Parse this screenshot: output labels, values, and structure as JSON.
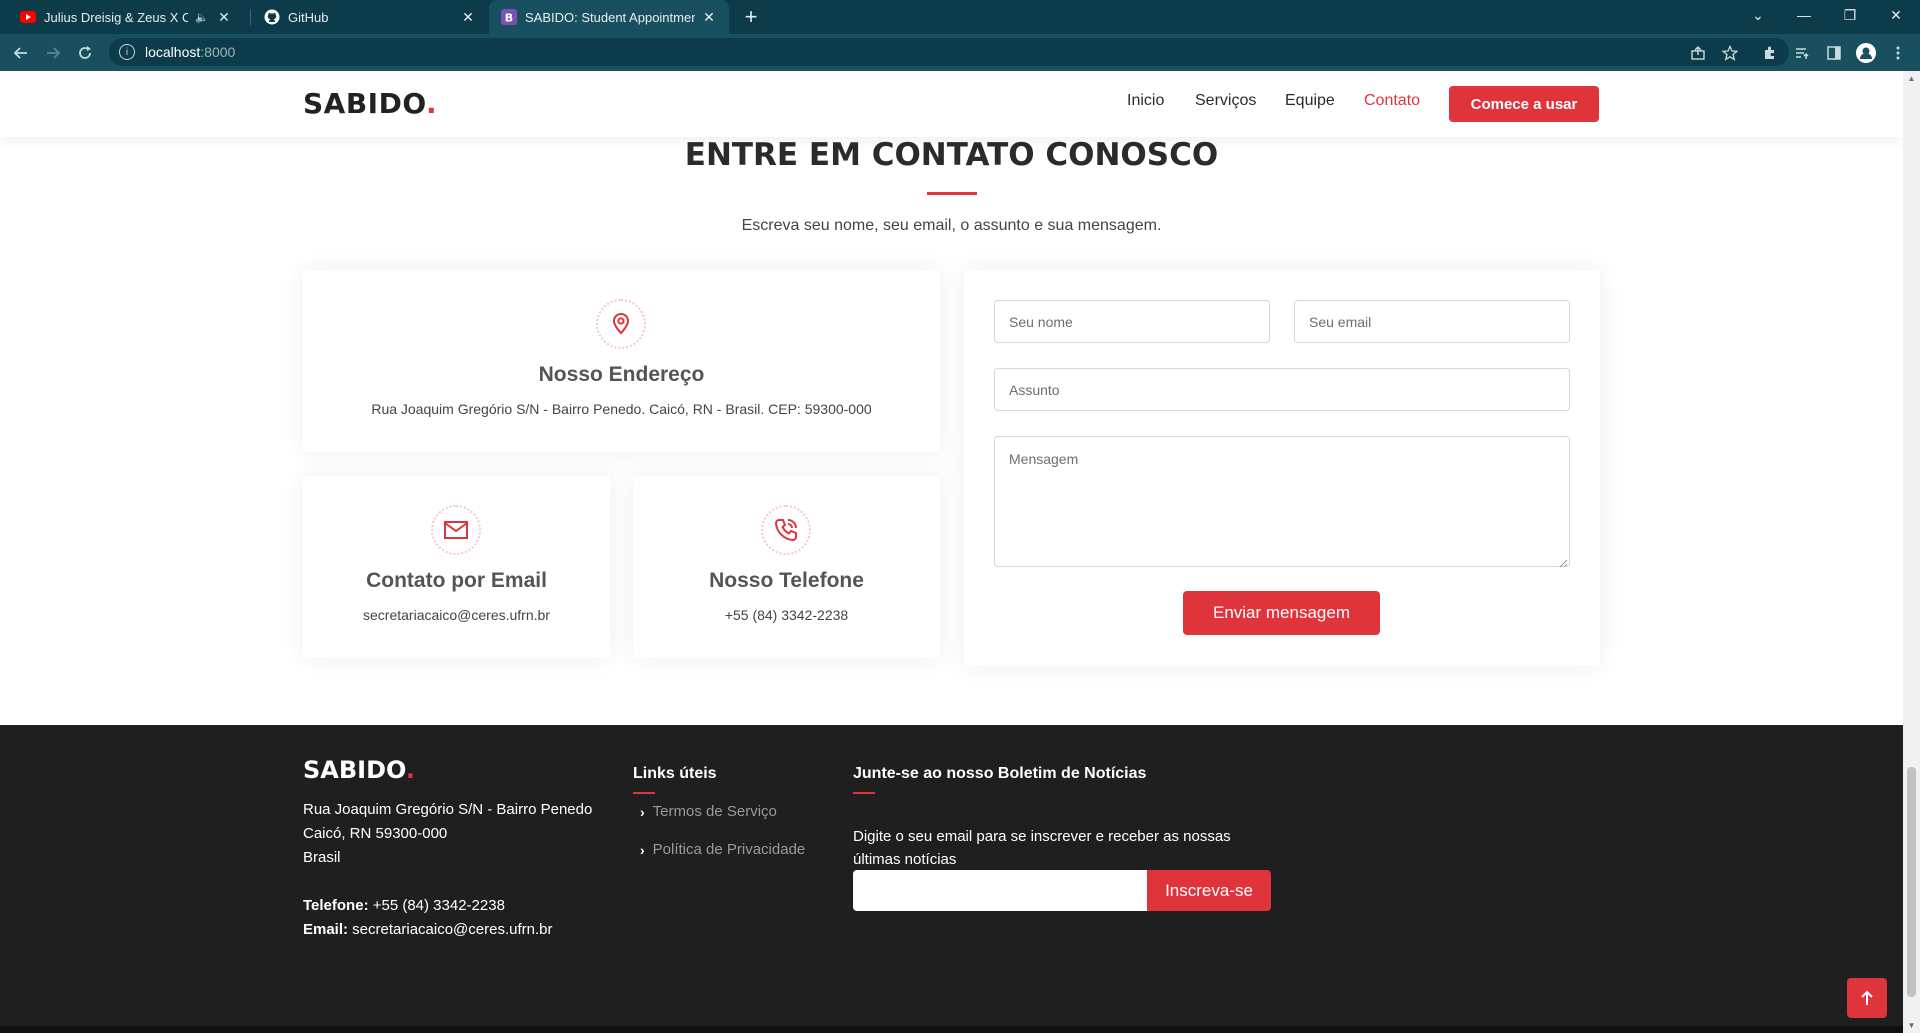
{
  "browser": {
    "tabs": [
      {
        "title": "Julius Dreisig & Zeus X Crona",
        "icon": "youtube-icon",
        "audio": true
      },
      {
        "title": "GitHub",
        "icon": "github-icon"
      },
      {
        "title": "SABIDO: Student Appointment Bo",
        "icon": "bootstrap-icon",
        "active": true
      }
    ],
    "url_host": "localhost",
    "url_port": ":8000"
  },
  "header": {
    "logo": "SABIDO",
    "logo_dot": ".",
    "nav": [
      "Inicio",
      "Serviços",
      "Equipe",
      "Contato"
    ],
    "active_nav": "Contato",
    "cta": "Comece a usar"
  },
  "contact": {
    "title": "ENTRE EM CONTATO CONOSCO",
    "subtitle": "Escreva seu nome, seu email, o assunto e sua mensagem.",
    "address": {
      "title": "Nosso Endereço",
      "text": "Rua Joaquim Gregório S/N - Bairro Penedo. Caicó, RN - Brasil. CEP: 59300-000",
      "icon": "map-pin-icon"
    },
    "email": {
      "title": "Contato por Email",
      "text": "secretariacaico@ceres.ufrn.br",
      "icon": "envelope-icon"
    },
    "phone": {
      "title": "Nosso Telefone",
      "text": "+55 (84) 3342-2238",
      "icon": "phone-icon"
    },
    "form": {
      "name_placeholder": "Seu nome",
      "email_placeholder": "Seu email",
      "subject_placeholder": "Assunto",
      "message_placeholder": "Mensagem",
      "submit": "Enviar mensagem"
    }
  },
  "footer": {
    "logo": "SABIDO",
    "logo_dot": ".",
    "address_line1": "Rua Joaquim Gregório S/N - Bairro Penedo",
    "address_line2": "Caicó, RN 59300-000",
    "address_line3": "Brasil",
    "phone_label": "Telefone:",
    "phone_value": " +55 (84) 3342-2238",
    "email_label": "Email:",
    "email_value": " secretariacaico@ceres.ufrn.br",
    "links_title": "Links úteis",
    "links": [
      "Termos de Serviço",
      "Política de Privacidade"
    ],
    "newsletter_title": "Junte-se ao nosso Boletim de Notícias",
    "newsletter_text": "Digite o seu email para se inscrever e receber as nossas últimas notícias",
    "newsletter_button": "Inscreva-se"
  },
  "colors": {
    "accent": "#e0343c",
    "footer_bg": "#1f1f1f",
    "chrome_dark": "#0c3b49",
    "chrome_light": "#18505f"
  }
}
